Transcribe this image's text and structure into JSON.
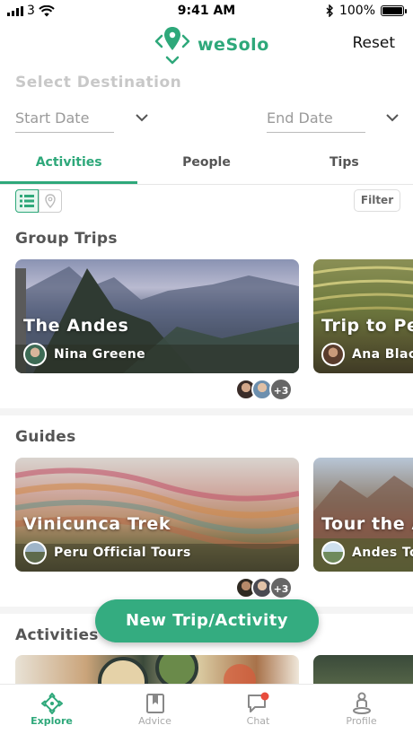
{
  "status_bar": {
    "signal": "3",
    "time": "9:41 AM",
    "battery": "100%"
  },
  "header": {
    "brand": "weSolo",
    "reset_label": "Reset"
  },
  "destination": {
    "title": "Select Destination",
    "start_placeholder": "Start Date",
    "end_placeholder": "End Date"
  },
  "tabs": [
    {
      "label": "Activities"
    },
    {
      "label": "People"
    },
    {
      "label": "Tips"
    }
  ],
  "toolbar": {
    "filter_label": "Filter"
  },
  "sections": {
    "group_trips": {
      "title": "Group Trips",
      "cards": [
        {
          "title": "The Andes",
          "owner": "Nina Greene"
        },
        {
          "title": "Trip to Per",
          "owner": "Ana Black"
        }
      ],
      "participants_more": "+3"
    },
    "guides": {
      "title": "Guides",
      "cards": [
        {
          "title": "Vinicunca Trek",
          "owner": "Peru Official Tours"
        },
        {
          "title": "Tour the A",
          "owner": "Andes To"
        }
      ],
      "participants_more": "+3"
    },
    "activities": {
      "title": "Activities"
    }
  },
  "fab_label": "New Trip/Activity",
  "bottom_nav": [
    {
      "label": "Explore",
      "icon": "compass-icon",
      "active": true
    },
    {
      "label": "Advice",
      "icon": "book-icon",
      "active": false
    },
    {
      "label": "Chat",
      "icon": "chat-icon",
      "active": false
    },
    {
      "label": "Profile",
      "icon": "person-pin-icon",
      "active": false
    }
  ],
  "colors": {
    "accent": "#2ea87a",
    "fab": "#34ac80",
    "notification": "#e84c3d"
  }
}
